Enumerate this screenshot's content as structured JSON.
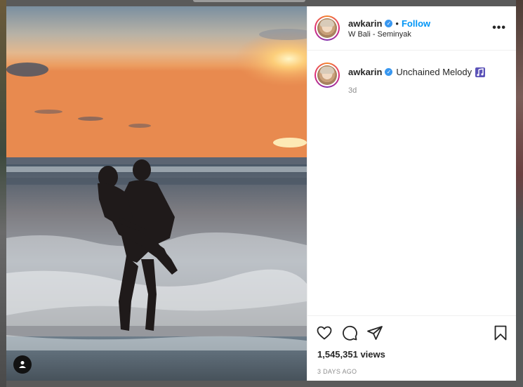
{
  "post": {
    "username": "awkarin",
    "follow_label": "Follow",
    "separator": "•",
    "location": "W Bali - Seminyak",
    "more_label": "•••",
    "caption_username": "awkarin",
    "caption_text": "Unchained Melody",
    "caption_time": "3d",
    "views": "1,545,351 views",
    "date": "3 DAYS AGO"
  },
  "icons": {
    "header_more": "more-options-icon",
    "verified": "verified-badge-icon",
    "music": "music-note-icon",
    "like": "heart-icon",
    "comment": "comment-icon",
    "share": "paper-plane-icon",
    "save": "bookmark-icon",
    "tag": "user-tag-icon"
  },
  "colors": {
    "accent": "#0095f6",
    "verified": "#3897f0"
  }
}
